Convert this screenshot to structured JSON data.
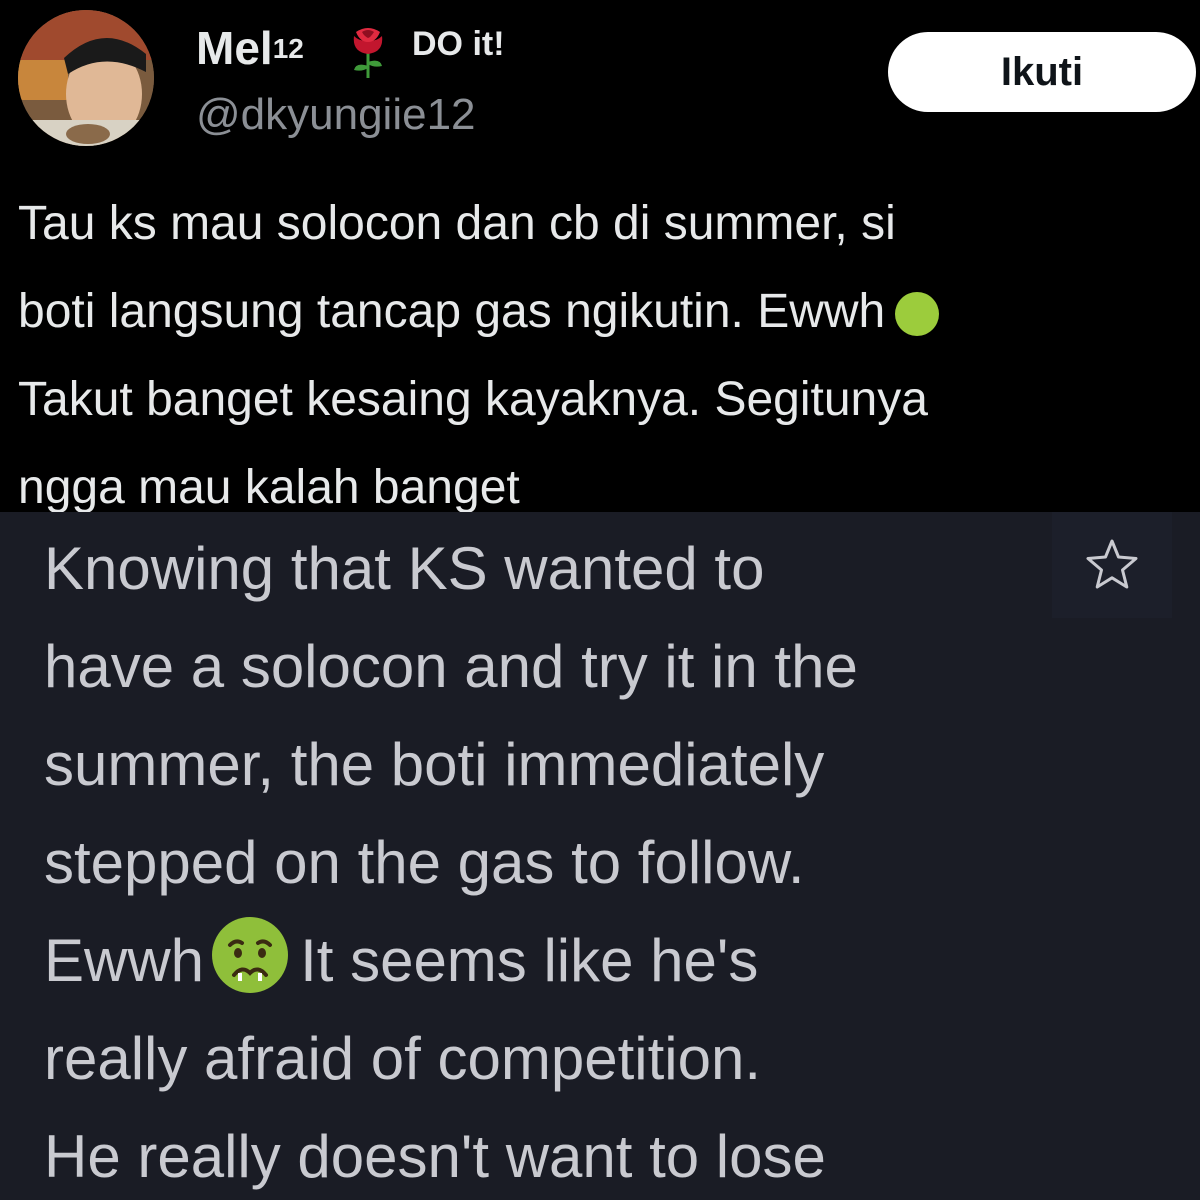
{
  "tweet": {
    "display_name": "Mel",
    "display_name_sup": "12",
    "name_suffix": "DO it!",
    "handle": "@dkyungiie12",
    "follow_label": "Ikuti",
    "lines": [
      "Tau ks mau solocon dan cb di summer, si",
      "boti langsung tancap gas ngikutin. Ewwh",
      "Takut banget kesaing kayaknya. Segitunya",
      "ngga mau kalah banget"
    ]
  },
  "translation": {
    "lines": [
      "Knowing that KS wanted to",
      "have a solocon and try it in the",
      "summer, the boti immediately",
      "stepped on the gas to follow.",
      "Ewwh",
      "It seems like he's",
      "really afraid of competition.",
      "He really doesn't want to lose"
    ]
  },
  "icons": {
    "name_icon": "rose-icon",
    "inline_emoji": "nauseated-face-icon",
    "star": "star-icon"
  },
  "colors": {
    "background_top": "#000000",
    "background_translation": "#1a1c25",
    "text_primary": "#e7e9ea",
    "text_secondary": "#8b8f95",
    "translation_text": "#c9cad0",
    "follow_button_bg": "#ffffff"
  }
}
